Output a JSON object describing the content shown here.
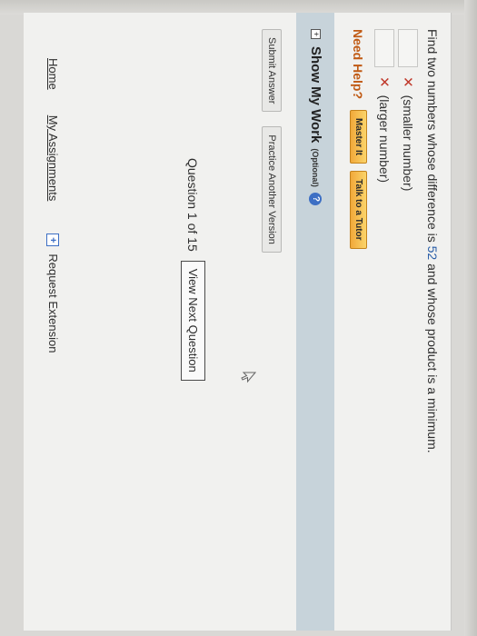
{
  "question": {
    "prefix": "Find two numbers whose difference is ",
    "number": "52",
    "suffix": " and whose product is a minimum."
  },
  "answers": [
    {
      "mark": "✕",
      "label": "(smaller number)"
    },
    {
      "mark": "✕",
      "label": "(larger number)"
    }
  ],
  "help": {
    "title": "Need Help?",
    "master_it": "Master It",
    "talk_to_tutor": "Talk to a Tutor"
  },
  "show_work": {
    "toggle": "+",
    "label": "Show My Work",
    "optional": "(Optional)",
    "help_icon": "?"
  },
  "actions": {
    "submit": "Submit Answer",
    "practice": "Practice Another Version"
  },
  "progress": {
    "text": "Question 1 of 15",
    "next": "View Next Question"
  },
  "footer": {
    "home": "Home",
    "assignments": "My Assignments",
    "extension_icon": "+",
    "extension": "Request Extension"
  },
  "colors": {
    "accent_number": "#2a5ea8",
    "need_help": "#c05a14",
    "help_button": "#f1a93a",
    "show_work_bar": "#c7d3da",
    "error_mark": "#c0392b"
  }
}
